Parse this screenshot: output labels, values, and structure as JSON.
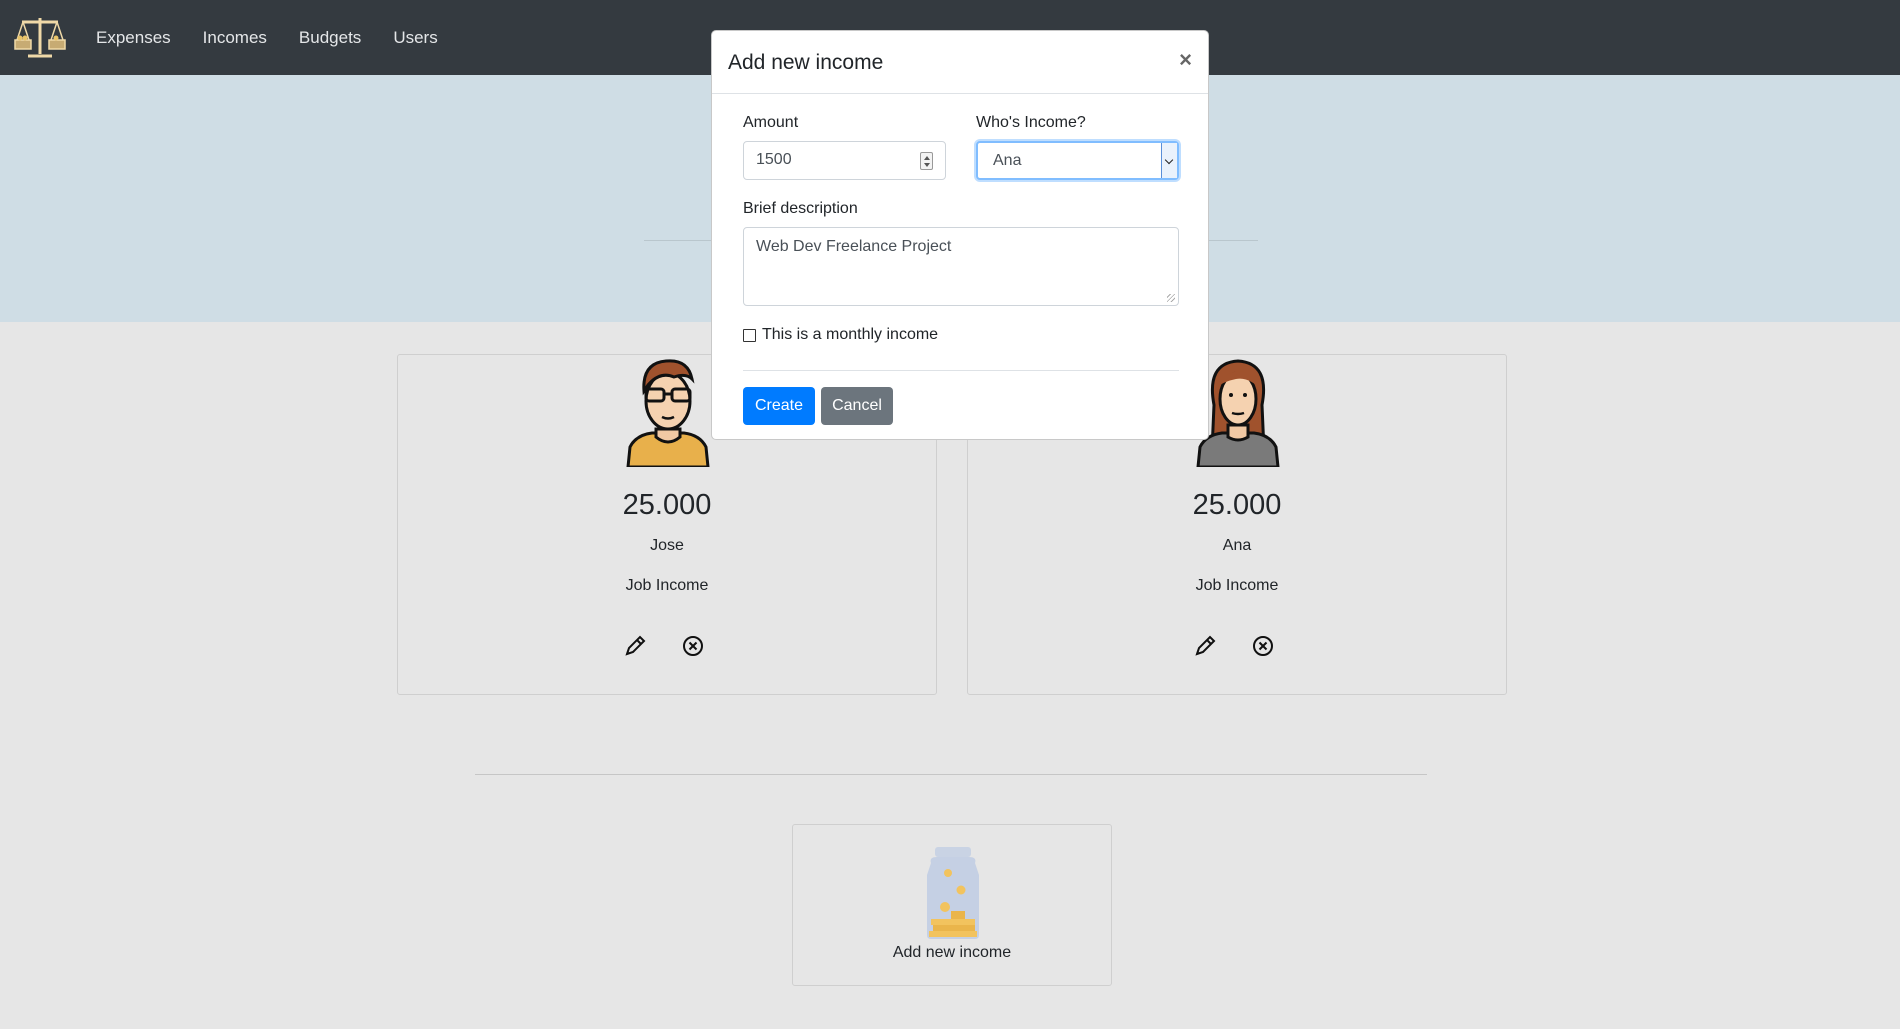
{
  "nav": {
    "items": [
      "Expenses",
      "Incomes",
      "Budgets",
      "Users"
    ]
  },
  "incomes": [
    {
      "amount": "25.000",
      "person": "Jose",
      "kind": "Job Income"
    },
    {
      "amount": "25.000",
      "person": "Ana",
      "kind": "Job Income"
    }
  ],
  "add_card": {
    "label": "Add new income"
  },
  "modal": {
    "title": "Add new income",
    "close": "×",
    "amount_label": "Amount",
    "amount_value": "1500",
    "who_label": "Who's Income?",
    "who_value": "Ana",
    "desc_label": "Brief description",
    "desc_value": "Web Dev Freelance Project",
    "monthly_label": "This is a monthly income",
    "monthly_checked": false,
    "create_label": "Create",
    "cancel_label": "Cancel"
  },
  "colors": {
    "navbar": "#343a40",
    "hero": "#cfdde5",
    "primary": "#007bff",
    "secondary": "#6c757d"
  }
}
